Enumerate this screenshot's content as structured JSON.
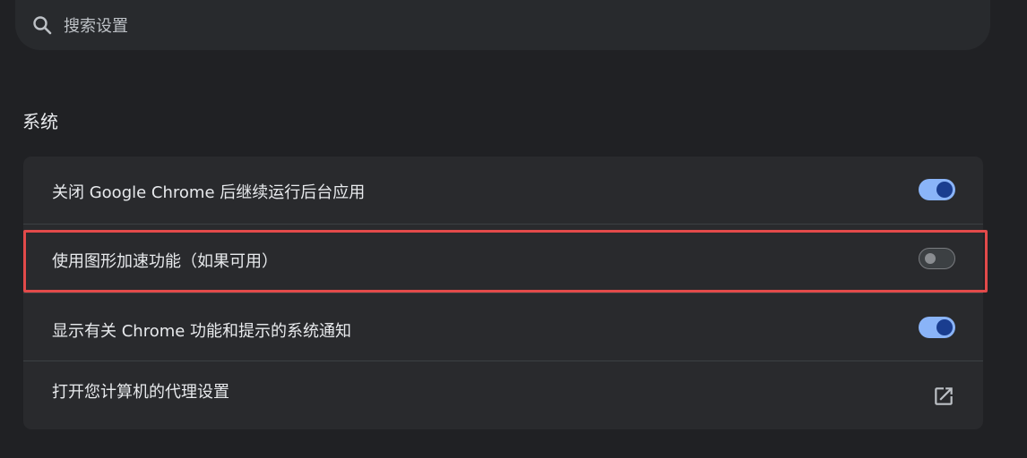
{
  "search": {
    "placeholder": "搜索设置",
    "icon": "search-icon"
  },
  "section": {
    "title": "系统"
  },
  "settings": [
    {
      "label": "关闭 Google Chrome 后继续运行后台应用",
      "control": "toggle",
      "state": "on"
    },
    {
      "label": "使用图形加速功能（如果可用）",
      "control": "toggle",
      "state": "off"
    },
    {
      "label": "显示有关 Chrome 功能和提示的系统通知",
      "control": "toggle",
      "state": "on"
    },
    {
      "label": "打开您计算机的代理设置",
      "control": "external-link",
      "icon": "open-in-new-icon"
    }
  ],
  "colors": {
    "background": "#202124",
    "accent": "#8ab4f8",
    "highlight": "#e24a4a"
  }
}
